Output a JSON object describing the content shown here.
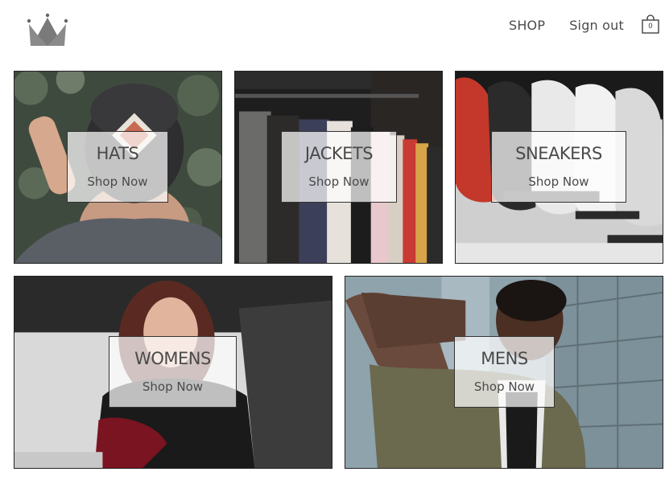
{
  "header": {
    "logo_icon": "crown-icon",
    "nav": {
      "shop_label": "SHOP",
      "signout_label": "Sign out",
      "cart_icon": "shopping-bag-icon",
      "cart_count": "0"
    }
  },
  "directory": {
    "sections": [
      {
        "title": "HATS",
        "subtitle": "Shop Now"
      },
      {
        "title": "JACKETS",
        "subtitle": "Shop Now"
      },
      {
        "title": "SNEAKERS",
        "subtitle": "Shop Now"
      },
      {
        "title": "WOMENS",
        "subtitle": "Shop Now"
      },
      {
        "title": "MENS",
        "subtitle": "Shop Now"
      }
    ]
  },
  "colors": {
    "text": "#4a4a4a",
    "border": "#222222",
    "overlay": "rgba(255,255,255,0.72)"
  }
}
